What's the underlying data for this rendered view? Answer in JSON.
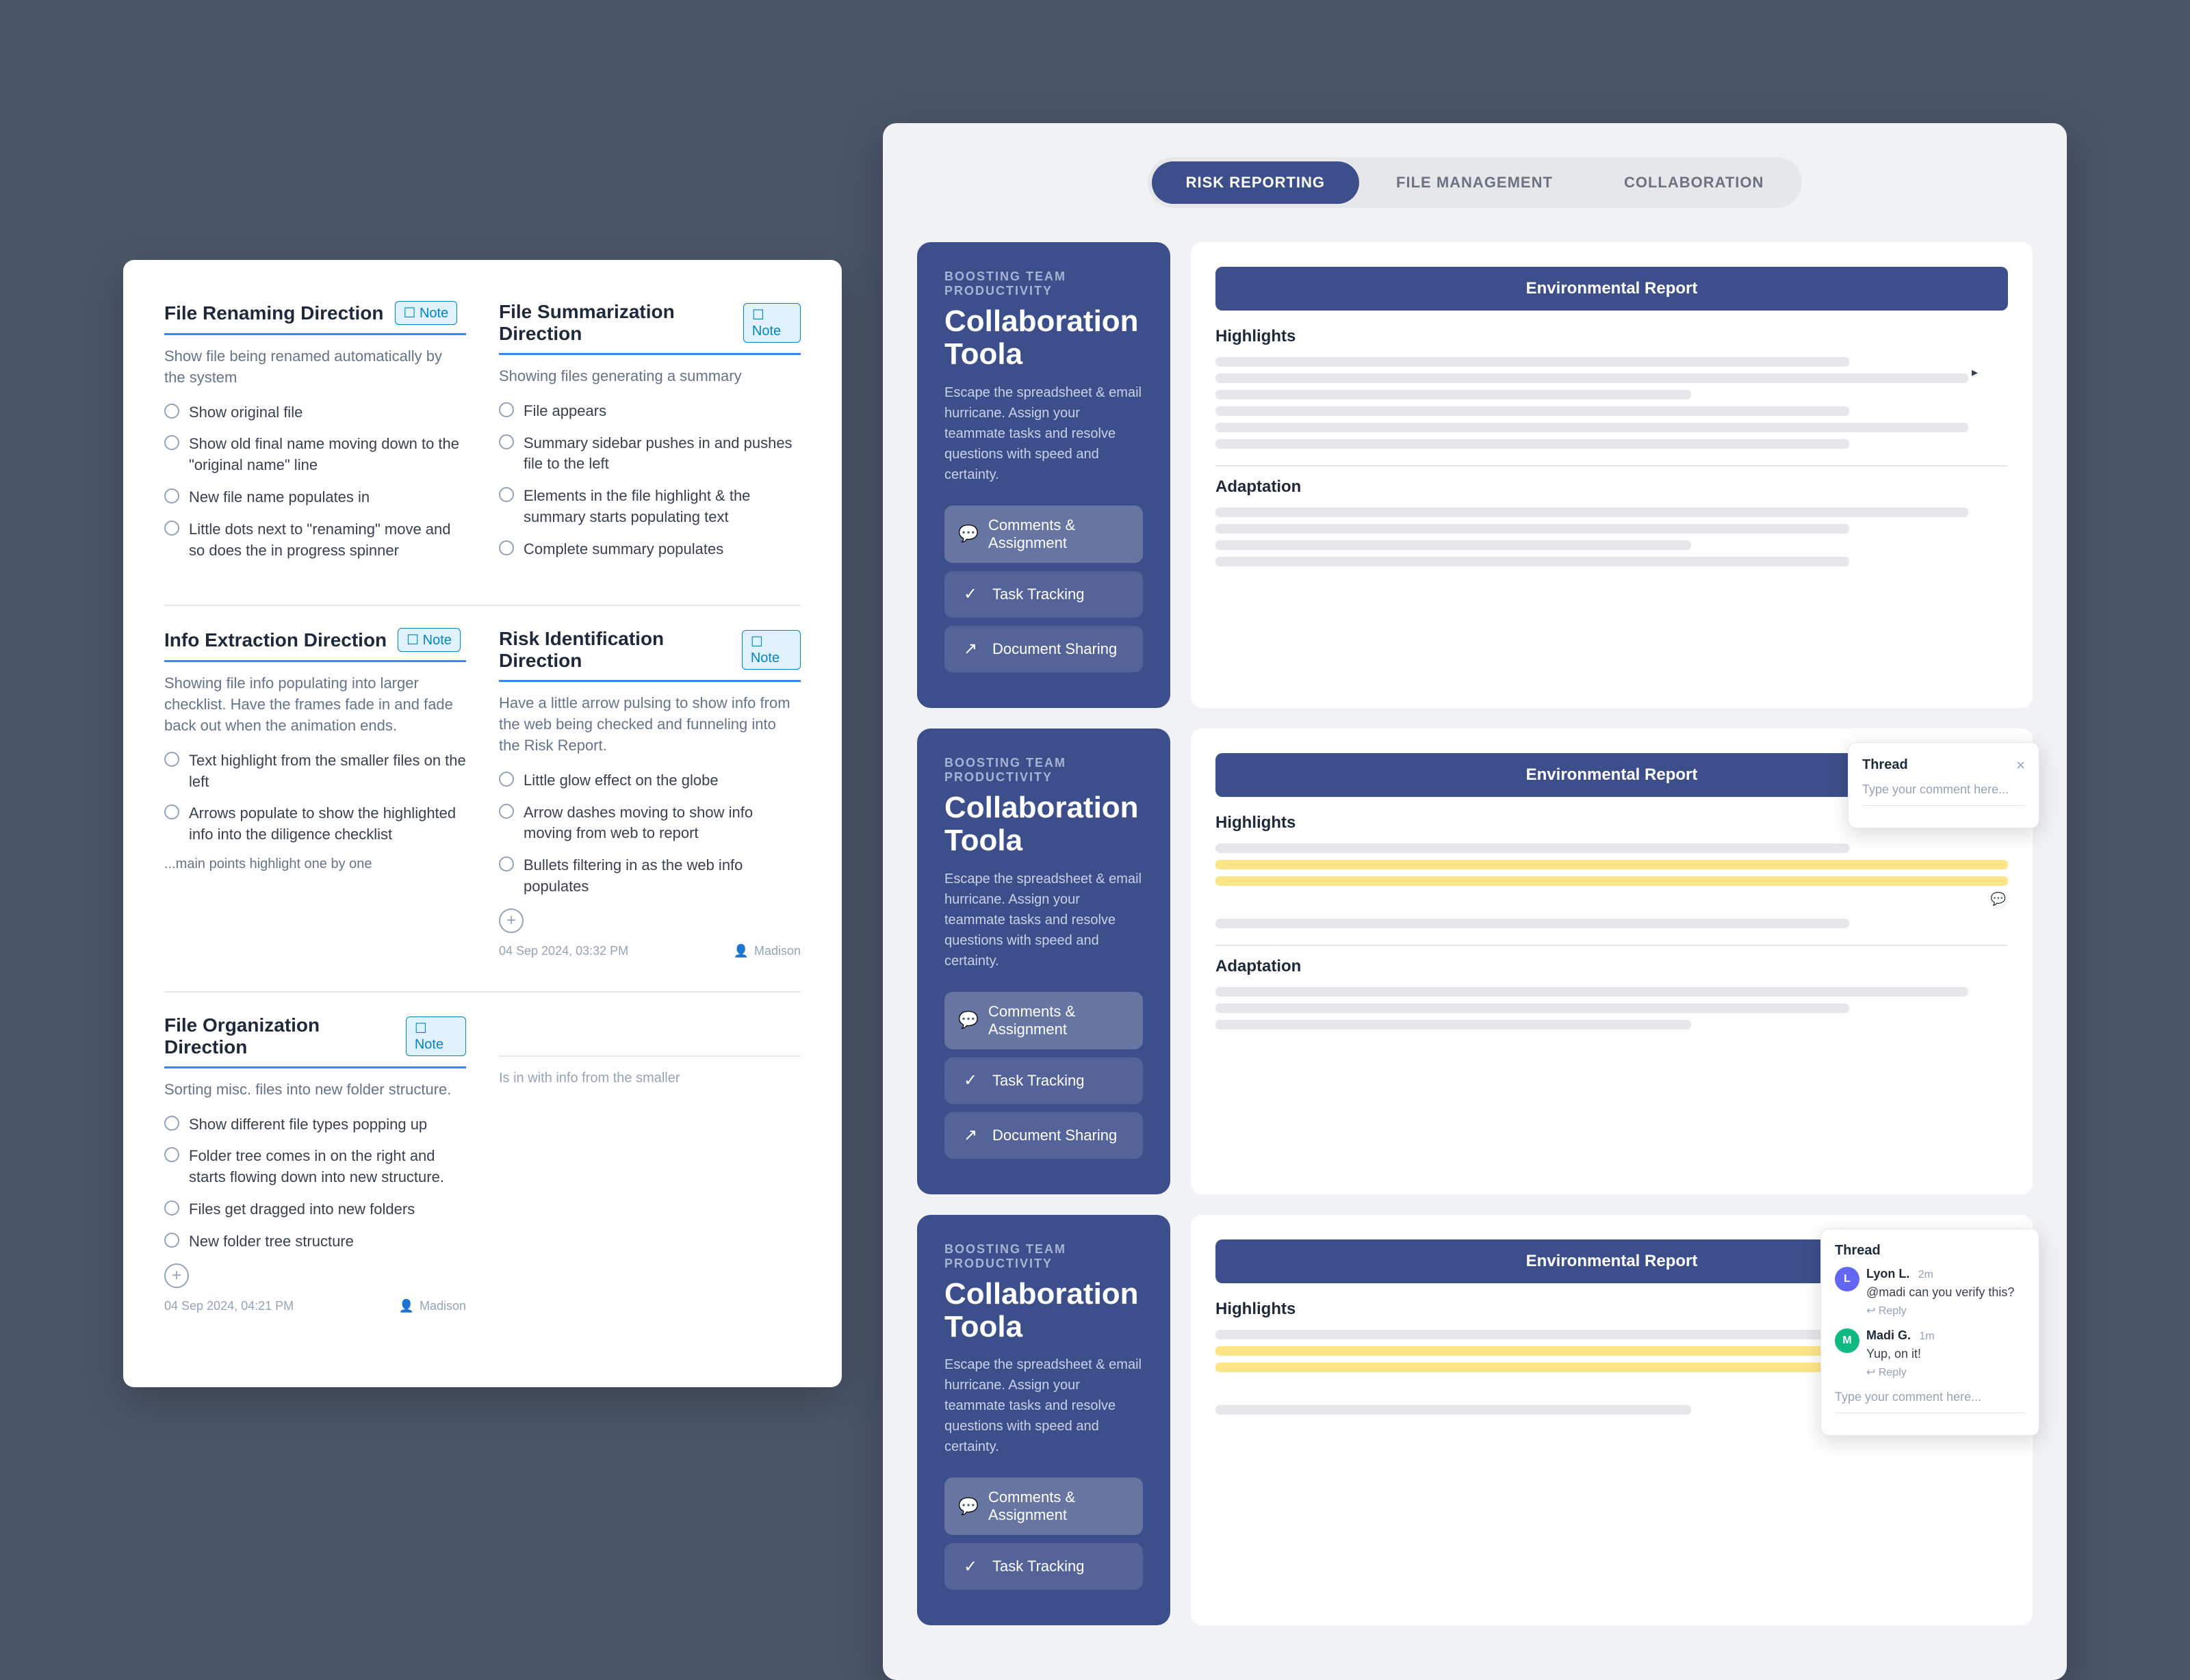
{
  "tabs": {
    "active": "RISK REPORTING",
    "items": [
      "RISK REPORTING",
      "FILE MANAGEMENT",
      "COLLABORATION"
    ]
  },
  "left_panel": {
    "sections": [
      {
        "id": "file-renaming",
        "title": "File Renaming Direction",
        "has_note": true,
        "desc": "Show file being renamed automatically by the system",
        "items": [
          "Show original file",
          "Show old final name moving down to the \"original name\" line",
          "New file name populates in",
          "Little dots next to \"renaming\" move and so does the in progress spinner"
        ]
      },
      {
        "id": "file-summarization",
        "title": "File Summarization Direction",
        "has_note": true,
        "desc": "Showing files generating a summary",
        "items": [
          "File appears",
          "Summary sidebar pushes in and pushes file to the left",
          "Elements in the file highlight & the summary starts populating text",
          "Complete summary populates"
        ]
      },
      {
        "id": "info-extraction",
        "title": "Info Extraction Direction",
        "has_note": true,
        "desc": "Showing file info populating into larger checklist. Have the frames fade in and fade back out when the animation ends.",
        "items": [
          "Text highlight from the smaller files on the left",
          "Arrows populate to show the highlighted info into the diligence checklist"
        ],
        "extra": "...main points highlight one by one"
      },
      {
        "id": "file-organization",
        "title": "File Organization Direction",
        "has_note": true,
        "desc": "Sorting misc. files into new folder structure.",
        "items": [
          "Show different file types popping up",
          "Folder tree comes in on the right and starts flowing down into new structure.",
          "Files get dragged into new folders",
          "New folder tree structure"
        ],
        "timestamp": "04 Sep 2024, 04:21 PM",
        "priority": "Madison"
      },
      {
        "id": "risk-identification",
        "title": "Risk Identification Direction",
        "has_note": true,
        "desc": "Have a little arrow pulsing to show info from the web being checked and funneling into the Risk Report.",
        "items": [
          "Little glow effect on the globe",
          "Arrow dashes moving to show info moving from web to report",
          "Bullets filtering in as the web info populates"
        ],
        "timestamp": "04 Sep 2024, 03:32 PM",
        "priority": "Madison"
      }
    ]
  },
  "app_cards": [
    {
      "label": "BOOSTING TEAM PRODUCTIVITY",
      "title": "Collaboration Toola",
      "desc": "Escape the spreadsheet & email hurricane. Assign your teammate tasks and resolve questions with speed and certainty.",
      "features": [
        {
          "id": "comments",
          "label": "Comments & Assignment",
          "icon": "💬",
          "active": true
        },
        {
          "id": "tracking",
          "label": "Task Tracking",
          "icon": "✓"
        },
        {
          "id": "sharing",
          "label": "Document Sharing",
          "icon": "↗"
        }
      ]
    }
  ],
  "report": {
    "title": "Environmental Report",
    "sections": [
      {
        "label": "Highlights"
      },
      {
        "label": "Adaptation"
      }
    ]
  },
  "thread_empty": {
    "title": "Thread",
    "placeholder": "Type your comment here..."
  },
  "thread_with_comments": {
    "title": "Thread",
    "close_label": "×",
    "comments": [
      {
        "author": "Lyon L.",
        "time": "2m",
        "avatar": "L",
        "color": "purple",
        "text": "@madi can you verify this?",
        "reply": "↩ Reply"
      },
      {
        "author": "Madi G.",
        "time": "1m",
        "avatar": "M",
        "color": "green",
        "text": "Yup, on it!",
        "reply": "↩ Reply"
      }
    ],
    "placeholder": "Type your comment here..."
  }
}
